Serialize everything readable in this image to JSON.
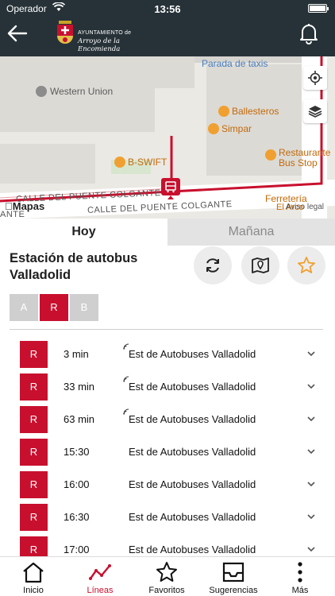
{
  "status_bar": {
    "carrier": "Operador",
    "time": "13:56"
  },
  "header": {
    "logo_line1": "AYUNTAMIENTO de",
    "logo_line2": "Arroyo de la Encomienda"
  },
  "map": {
    "labels": {
      "taxi": "Parada de taxis",
      "western_union": "Western Union",
      "ballesteros": "Ballesteros",
      "simpar": "Simpar",
      "bswift": "B-SWIFT",
      "restaurant_1": "Restaurante",
      "restaurant_2": "Bus Stop",
      "ferreteria_1": "Ferretería",
      "ferreteria_2": "El Arco",
      "street_1": "CALLE DEL PUENTE COLGANTE",
      "street_2": "CALLE DEL PUENTE COLGANTE",
      "street_partial": "ANTE"
    },
    "apple_maps": "Mapas",
    "legal": "Aviso legal"
  },
  "tabs": {
    "today": "Hoy",
    "tomorrow": "Mañana"
  },
  "stop": {
    "name": "Estación de autobus Valladolid"
  },
  "lines": [
    "A",
    "R",
    "B"
  ],
  "departures": [
    {
      "line": "R",
      "time": "3 min",
      "destination": "Est de Autobuses Valladolid",
      "realtime": true
    },
    {
      "line": "R",
      "time": "33 min",
      "destination": "Est de Autobuses Valladolid",
      "realtime": true
    },
    {
      "line": "R",
      "time": "63 min",
      "destination": "Est de Autobuses Valladolid",
      "realtime": true
    },
    {
      "line": "R",
      "time": "15:30",
      "destination": "Est de Autobuses Valladolid",
      "realtime": false
    },
    {
      "line": "R",
      "time": "16:00",
      "destination": "Est de Autobuses Valladolid",
      "realtime": false
    },
    {
      "line": "R",
      "time": "16:30",
      "destination": "Est de Autobuses Valladolid",
      "realtime": false
    },
    {
      "line": "R",
      "time": "17:00",
      "destination": "Est de Autobuses Valladolid",
      "realtime": false
    }
  ],
  "nav": {
    "inicio": "Inicio",
    "lineas": "Líneas",
    "favoritos": "Favoritos",
    "sugerencias": "Sugerencias",
    "mas": "Más"
  },
  "colors": {
    "header_bg": "#263238",
    "accent": "#c8102e",
    "favorite": "#f0a030"
  }
}
